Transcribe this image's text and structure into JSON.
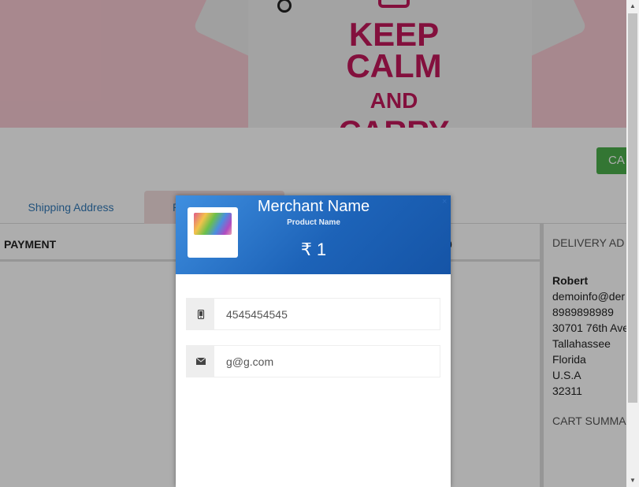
{
  "banner": {
    "keep_text": [
      "KEEP",
      "CALM",
      "AND",
      "CARRY"
    ]
  },
  "cart_button": {
    "label": "CA"
  },
  "tabs": [
    {
      "label": "Shipping Address"
    },
    {
      "label": "P"
    }
  ],
  "payment": {
    "title": "PAYMENT",
    "amount_fragment": "0"
  },
  "delivery": {
    "heading": "DELIVERY AD",
    "name": "Robert",
    "email": "demoinfo@der",
    "phone": "8989898989",
    "street": "30701 76th Ave",
    "city": "Tallahassee",
    "state": "Florida",
    "country": "U.S.A",
    "zip": "32311",
    "cart_summary": "CART SUMMA"
  },
  "modal": {
    "merchant_name": "Merchant Name",
    "product_name": "Product Name",
    "amount": "₹ 1",
    "close_glyph": "×",
    "phone_value": "4545454545",
    "email_value": "g@g.com",
    "phone_icon": "phone-icon",
    "email_icon": "envelope-icon"
  },
  "colors": {
    "header_start": "#3f8fe0",
    "header_end": "#1554a6",
    "cart_green": "#4cae4c",
    "banner_pink": "#f7c9d2",
    "tagline_magenta": "#c2185b"
  }
}
